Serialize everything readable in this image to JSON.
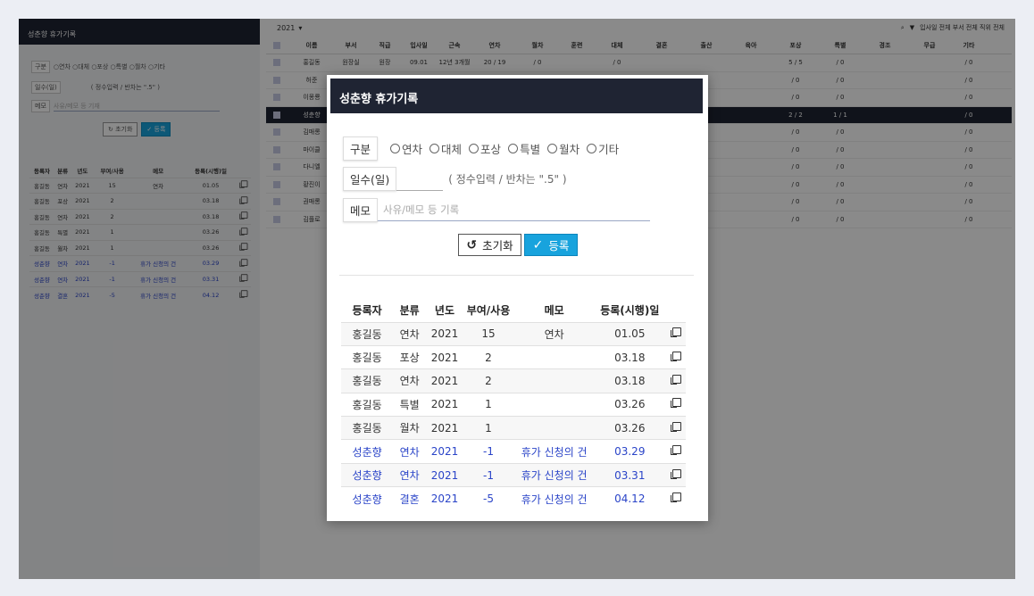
{
  "bg_left": {
    "title": "성춘향 휴가기록",
    "type_label": "구분",
    "type_options": "○연차 ○대체 ○포상 ○특별 ○월차 ○기타",
    "days_label": "일수(일)",
    "days_hint": "( 정수입력 / 반차는 \".5\" )",
    "memo_label": "메모",
    "memo_placeholder": "사유/메모 등 기재",
    "reset": "초기화",
    "save": "등록"
  },
  "bg_right": {
    "year": "2021",
    "filter_text": "입사일 전체  부서 전체  직위 전체",
    "headers": [
      "이름",
      "부서",
      "직급",
      "입사일",
      "근속",
      "연차",
      "월차",
      "훈련",
      "대체",
      "결혼",
      "출산",
      "육아",
      "포상",
      "특별",
      "경조",
      "무급",
      "기타"
    ],
    "rows": [
      {
        "name": "홍길동",
        "dept": "원장실",
        "rank": "원장",
        "join": "09.01",
        "tenure": "12년 3개월",
        "annual": "20 / 19",
        "monthly": "/ 0",
        "sub": "/ 0",
        "reward": "5 / 5",
        "special": "/ 0",
        "etc": "/ 0",
        "sel": false
      },
      {
        "name": "허준",
        "dept": "",
        "rank": "",
        "join": "",
        "tenure": "",
        "annual": "",
        "monthly": "",
        "sub": "",
        "reward": "/ 0",
        "special": "/ 0",
        "etc": "/ 0",
        "sel": false
      },
      {
        "name": "이몽룡",
        "dept": "",
        "rank": "",
        "join": "",
        "tenure": "",
        "annual": "",
        "monthly": "",
        "sub": "",
        "reward": "/ 0",
        "special": "/ 0",
        "etc": "/ 0",
        "sel": false
      },
      {
        "name": "성춘향",
        "dept": "",
        "rank": "",
        "join": "",
        "tenure": "",
        "annual": "",
        "monthly": "",
        "sub": "",
        "reward": "2 / 2",
        "special": "1 / 1",
        "etc": "/ 0",
        "sel": true
      },
      {
        "name": "김매롱",
        "dept": "",
        "rank": "",
        "join": "",
        "tenure": "",
        "annual": "",
        "monthly": "",
        "sub": "",
        "reward": "/ 0",
        "special": "/ 0",
        "etc": "/ 0",
        "sel": false
      },
      {
        "name": "마이클",
        "dept": "",
        "rank": "",
        "join": "",
        "tenure": "",
        "annual": "",
        "monthly": "",
        "sub": "",
        "reward": "/ 0",
        "special": "/ 0",
        "etc": "/ 0",
        "sel": false
      },
      {
        "name": "다니엘",
        "dept": "",
        "rank": "",
        "join": "",
        "tenure": "",
        "annual": "",
        "monthly": "",
        "sub": "",
        "reward": "/ 0",
        "special": "/ 0",
        "etc": "/ 0",
        "sel": false
      },
      {
        "name": "황진이",
        "dept": "",
        "rank": "",
        "join": "",
        "tenure": "",
        "annual": "",
        "monthly": "",
        "sub": "",
        "reward": "/ 0",
        "special": "/ 0",
        "etc": "/ 0",
        "sel": false
      },
      {
        "name": "권매롱",
        "dept": "",
        "rank": "",
        "join": "",
        "tenure": "",
        "annual": "",
        "monthly": "",
        "sub": "",
        "reward": "/ 0",
        "special": "/ 0",
        "etc": "/ 0",
        "sel": false
      },
      {
        "name": "김플로",
        "dept": "",
        "rank": "",
        "join": "",
        "tenure": "",
        "annual": "",
        "monthly": "",
        "sub": "",
        "reward": "/ 0",
        "special": "/ 0",
        "etc": "/ 0",
        "sel": false
      }
    ]
  },
  "modal": {
    "title": "성춘향 휴가기록",
    "type_label": "구분",
    "type_options": [
      "연차",
      "대체",
      "포상",
      "특별",
      "월차",
      "기타"
    ],
    "days_label": "일수(일)",
    "days_value": "",
    "days_hint": "( 정수입력 / 반차는 \".5\" )",
    "memo_label": "메모",
    "memo_placeholder": "사유/메모 등 기록",
    "reset_label": "초기화",
    "save_label": "등록",
    "columns": [
      "등록자",
      "분류",
      "년도",
      "부여/사용",
      "메모",
      "등록(시행)일"
    ],
    "records": [
      {
        "author": "홍길동",
        "type": "연차",
        "year": "2021",
        "amount": "15",
        "memo": "연차",
        "date": "01.05",
        "mine": false
      },
      {
        "author": "홍길동",
        "type": "포상",
        "year": "2021",
        "amount": "2",
        "memo": "",
        "date": "03.18",
        "mine": false
      },
      {
        "author": "홍길동",
        "type": "연차",
        "year": "2021",
        "amount": "2",
        "memo": "",
        "date": "03.18",
        "mine": false
      },
      {
        "author": "홍길동",
        "type": "특별",
        "year": "2021",
        "amount": "1",
        "memo": "",
        "date": "03.26",
        "mine": false
      },
      {
        "author": "홍길동",
        "type": "월차",
        "year": "2021",
        "amount": "1",
        "memo": "",
        "date": "03.26",
        "mine": false
      },
      {
        "author": "성춘향",
        "type": "연차",
        "year": "2021",
        "amount": "-1",
        "memo": "휴가 신청의 건",
        "date": "03.29",
        "mine": true
      },
      {
        "author": "성춘향",
        "type": "연차",
        "year": "2021",
        "amount": "-1",
        "memo": "휴가 신청의 건",
        "date": "03.31",
        "mine": true
      },
      {
        "author": "성춘향",
        "type": "결혼",
        "year": "2021",
        "amount": "-5",
        "memo": "휴가 신청의 건",
        "date": "04.12",
        "mine": true
      }
    ]
  },
  "colors": {
    "header_dark": "#1f2433",
    "accent_blue": "#18a3dd",
    "link_blue": "#2a44c8"
  }
}
